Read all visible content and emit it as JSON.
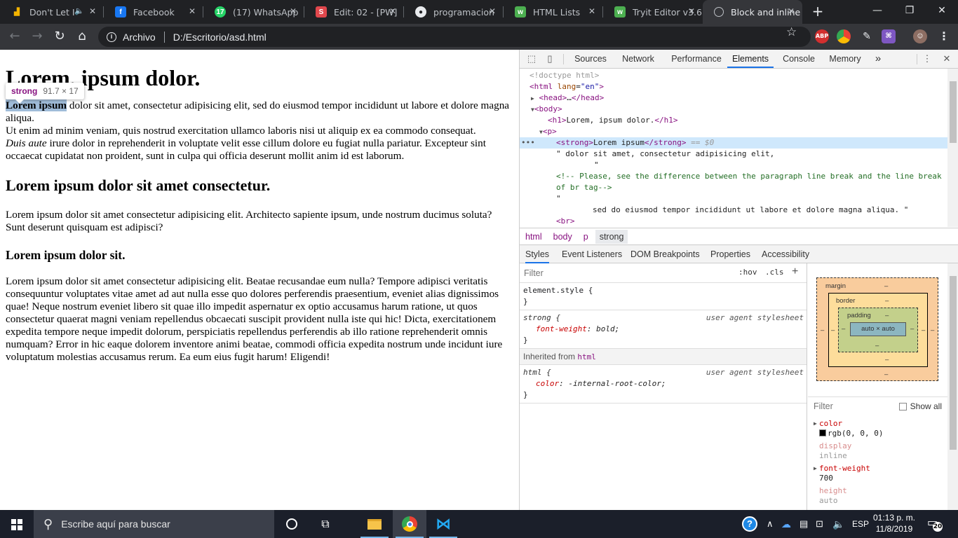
{
  "browser": {
    "tabs": [
      {
        "title": "Don't Let I",
        "favicon": "music-chart-icon",
        "color": "#202124",
        "audio": true
      },
      {
        "title": "Facebook",
        "favicon": "facebook-icon",
        "color": "#1877f2"
      },
      {
        "title": "(17) WhatsApp",
        "favicon": "whatsapp-icon",
        "color": "#25d366"
      },
      {
        "title": "Edit: 02 - [PW]",
        "favicon": "s-icon",
        "color": "#e0474c"
      },
      {
        "title": "programacion",
        "favicon": "github-icon",
        "color": "#202124"
      },
      {
        "title": "HTML Lists",
        "favicon": "w3schools-icon",
        "color": "#4caf50"
      },
      {
        "title": "Tryit Editor v3.6",
        "favicon": "w3schools-icon",
        "color": "#4caf50"
      },
      {
        "title": "Block and inline",
        "favicon": "globe-icon",
        "color": "#35363a",
        "active": true
      }
    ],
    "address": {
      "scheme_label": "Archivo",
      "url": "D:/Escritorio/asd.html"
    }
  },
  "page": {
    "h1": "Lorem, ipsum dolor.",
    "p1": {
      "strong": "Lorem ipsum",
      "rest1": " dolor sit amet, consectetur adipisicing elit, sed do eiusmod tempor incididunt ut labore et dolore magna aliqua.",
      "line2": "Ut enim ad minim veniam, quis nostrud exercitation ullamco laboris nisi ut aliquip ex ea commodo consequat.",
      "em": "Duis aute",
      "rest2": " irure dolor in reprehenderit in voluptate velit esse cillum dolore eu fugiat nulla pariatur. Excepteur sint occaecat cupidatat non proident, sunt in culpa qui officia deserunt mollit anim id est laborum."
    },
    "h2": "Lorem ipsum dolor sit amet consectetur.",
    "p2": "Lorem ipsum dolor sit amet consectetur adipisicing elit. Architecto sapiente ipsum, unde nostrum ducimus soluta? Sunt deserunt quisquam est adipisci?",
    "h3": "Lorem ipsum dolor sit.",
    "p3": "Lorem ipsum dolor sit amet consectetur adipisicing elit. Beatae recusandae eum nulla? Tempore adipisci veritatis consequuntur voluptates vitae amet ad aut nulla esse quo dolores perferendis praesentium, eveniet alias dignissimos quae! Neque nostrum eveniet libero sit quae illo impedit aspernatur ex optio accusamus harum ratione, ut quos consectetur quaerat magni veniam repellendus obcaecati suscipit provident nulla iste qui hic! Dicta, exercitationem expedita tempore neque impedit dolorum, perspiciatis repellendus perferendis ab illo ratione reprehenderit omnis numquam? Error in hic eaque dolorem inventore animi beatae, commodi officia expedita nostrum unde incidunt iure voluptatum molestias accusamus rerum. Ea eum eius fugit harum! Eligendi!",
    "tooltip": {
      "tag": "strong",
      "size": "91.7 × 17"
    }
  },
  "devtools": {
    "tabs": [
      "Sources",
      "Network",
      "Performance",
      "Elements",
      "Console",
      "Memory"
    ],
    "active_tab": "Elements",
    "more": "»",
    "dom": {
      "doctype": "<!doctype html>",
      "html_open": "html",
      "lang_attr": "lang",
      "lang_val": "\"en\"",
      "head": "head",
      "head_ellipsis": "…",
      "body": "body",
      "h1_text": "Lorem, ipsum dolor.",
      "p": "p",
      "strong": "strong",
      "strong_text": "Lorem ipsum",
      "dollar": " == $0",
      "text1": "\" dolor sit amet, consectetur adipisicing elit,",
      "text1b": "\"",
      "comment1": "<!-- Please, see the difference between the paragraph line break and the line break",
      "comment2": "of br tag-->",
      "text2a": "\"",
      "text2b": "sed do eiusmod tempor incididunt ut labore et dolore magna aliqua. \"",
      "br": "br",
      "dots": "•••"
    },
    "breadcrumbs": [
      "html",
      "body",
      "p",
      "strong"
    ],
    "subtabs": [
      "Styles",
      "Event Listeners",
      "DOM Breakpoints",
      "Properties",
      "Accessibility"
    ],
    "styles": {
      "filter_placeholder": "Filter",
      "hov": ":hov",
      "cls": ".cls",
      "add": "+",
      "element_style": "element.style {",
      "close_brace": "}",
      "strong_rule": {
        "selector": "strong {",
        "source": "user agent stylesheet",
        "prop": "font-weight",
        "value": "bold;"
      },
      "inherited_label": "Inherited from",
      "inherited_from": "html",
      "html_rule": {
        "selector": "html {",
        "source": "user agent stylesheet",
        "prop": "color",
        "value": "-internal-root-color;"
      }
    },
    "box_model": {
      "margin": "margin",
      "border": "border",
      "padding": "padding",
      "content": "auto × auto",
      "dash": "–"
    },
    "computed": {
      "filter_placeholder": "Filter",
      "show_all": "Show all",
      "props": [
        {
          "name": "color",
          "value": "rgb(0, 0, 0)",
          "expandable": true,
          "swatch": "#000000"
        },
        {
          "name": "display",
          "value": "inline",
          "dim": true
        },
        {
          "name": "font-weight",
          "value": "700",
          "expandable": true
        },
        {
          "name": "height",
          "value": "auto",
          "dim": true
        }
      ]
    }
  },
  "taskbar": {
    "search_placeholder": "Escribe aquí para buscar",
    "language": "ESP",
    "time": "01:13 p. m.",
    "date": "11/8/2019",
    "notifications": "20"
  }
}
